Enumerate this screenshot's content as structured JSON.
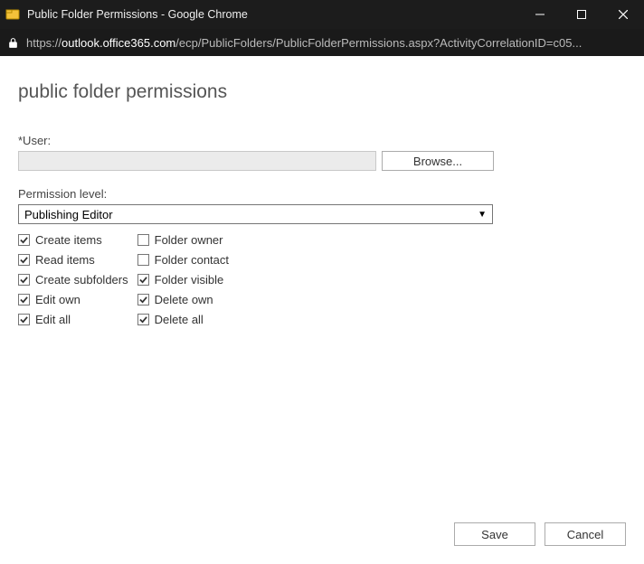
{
  "window": {
    "title": "Public Folder Permissions - Google Chrome"
  },
  "address": {
    "scheme": "https://",
    "domain": "outlook.office365.com",
    "path": "/ecp/PublicFolders/PublicFolderPermissions.aspx?ActivityCorrelationID=c05..."
  },
  "page": {
    "title": "public folder permissions",
    "user_label": "*User:",
    "user_value": "",
    "browse_label": "Browse...",
    "perm_label": "Permission level:",
    "perm_value": "Publishing Editor",
    "save_label": "Save",
    "cancel_label": "Cancel"
  },
  "checks": {
    "col1": [
      {
        "label": "Create items",
        "checked": true
      },
      {
        "label": "Read items",
        "checked": true
      },
      {
        "label": "Create subfolders",
        "checked": true
      },
      {
        "label": "Edit own",
        "checked": true
      },
      {
        "label": "Edit all",
        "checked": true
      }
    ],
    "col2": [
      {
        "label": "Folder owner",
        "checked": false
      },
      {
        "label": "Folder contact",
        "checked": false
      },
      {
        "label": "Folder visible",
        "checked": true
      },
      {
        "label": "Delete own",
        "checked": true
      },
      {
        "label": "Delete all",
        "checked": true
      }
    ]
  }
}
